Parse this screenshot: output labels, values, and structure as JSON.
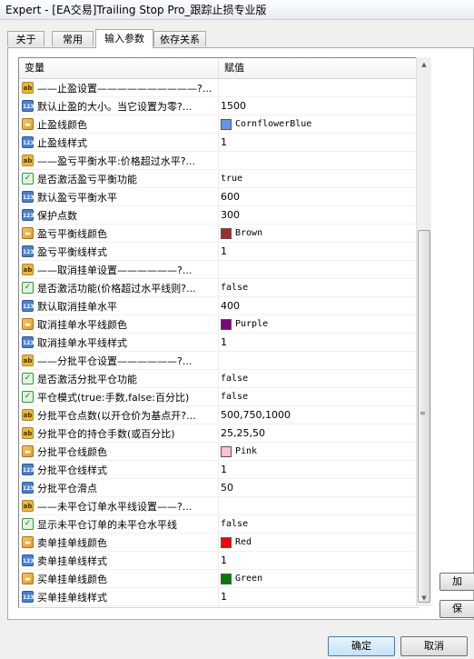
{
  "window": {
    "title": "Expert - [EA交易]Trailing Stop Pro_跟踪止损专业版"
  },
  "tabs": [
    {
      "label": "关于"
    },
    {
      "label": "常用"
    },
    {
      "label": "输入参数"
    },
    {
      "label": "依存关系"
    }
  ],
  "grid": {
    "col_variable": "变量",
    "col_value": "赋值",
    "rows": [
      {
        "icon": "ab",
        "name": "——止盈设置——————————?...",
        "value": ""
      },
      {
        "icon": "num",
        "name": "默认止盈的大小。当它设置为零?...",
        "value": "1500"
      },
      {
        "icon": "color",
        "name": "止盈线颜色",
        "value": "CornflowerBlue",
        "swatch": "#6495ED"
      },
      {
        "icon": "num",
        "name": "止盈线样式",
        "value": "1"
      },
      {
        "icon": "ab",
        "name": "——盈亏平衡水平:价格超过水平?...",
        "value": ""
      },
      {
        "icon": "bool",
        "name": "是否激活盈亏平衡功能",
        "value": "true"
      },
      {
        "icon": "num",
        "name": "默认盈亏平衡水平",
        "value": "600"
      },
      {
        "icon": "num",
        "name": "保护点数",
        "value": "300"
      },
      {
        "icon": "color",
        "name": "盈亏平衡线颜色",
        "value": "Brown",
        "swatch": "#A52A2A"
      },
      {
        "icon": "num",
        "name": "盈亏平衡线样式",
        "value": "1"
      },
      {
        "icon": "ab",
        "name": "——取消挂单设置——————?...",
        "value": ""
      },
      {
        "icon": "bool",
        "name": "是否激活功能(价格超过水平线则?...",
        "value": "false"
      },
      {
        "icon": "num",
        "name": "默认取消挂单水平",
        "value": "400"
      },
      {
        "icon": "color",
        "name": "取消挂单水平线颜色",
        "value": "Purple",
        "swatch": "#800080"
      },
      {
        "icon": "num",
        "name": "取消挂单水平线样式",
        "value": "1"
      },
      {
        "icon": "ab",
        "name": "——分批平仓设置——————?...",
        "value": ""
      },
      {
        "icon": "bool",
        "name": "是否激活分批平仓功能",
        "value": "false"
      },
      {
        "icon": "bool",
        "name": "平仓模式(true:手数,false:百分比)",
        "value": "false"
      },
      {
        "icon": "ab",
        "name": "分批平仓点数(以开仓价为基点开?...",
        "value": "500,750,1000"
      },
      {
        "icon": "ab",
        "name": "分批平仓的持仓手数(或百分比)",
        "value": "25,25,50"
      },
      {
        "icon": "color",
        "name": "分批平仓线颜色",
        "value": "Pink",
        "swatch": "#FFC0CB"
      },
      {
        "icon": "num",
        "name": "分批平仓线样式",
        "value": "1"
      },
      {
        "icon": "num",
        "name": "分批平仓滑点",
        "value": "50"
      },
      {
        "icon": "ab",
        "name": "——未平仓订单水平线设置——?...",
        "value": ""
      },
      {
        "icon": "bool",
        "name": "显示未平仓订单的未平仓水平线",
        "value": "false"
      },
      {
        "icon": "color",
        "name": "卖单挂单线颜色",
        "value": "Red",
        "swatch": "#FF0000"
      },
      {
        "icon": "num",
        "name": "卖单挂单线样式",
        "value": "1"
      },
      {
        "icon": "color",
        "name": "买单挂单线颜色",
        "value": "Green",
        "swatch": "#008000"
      },
      {
        "icon": "num",
        "name": "买单挂单线样式",
        "value": "1"
      }
    ]
  },
  "side_buttons": {
    "load": "加",
    "save": "保"
  },
  "footer": {
    "ok": "确定",
    "cancel": "取消"
  },
  "icon_names": {
    "ab": "string-param-icon",
    "num": "integer-param-icon",
    "bool": "boolean-param-icon",
    "color": "color-param-icon"
  },
  "icon_glyphs": {
    "ab": "ab",
    "num": "123",
    "bool": "✓",
    "color": "▬"
  }
}
